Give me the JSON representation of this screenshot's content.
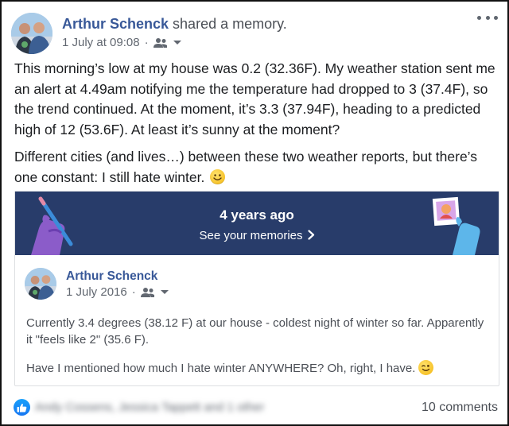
{
  "post": {
    "author": "Arthur Schenck",
    "action": " shared a memory.",
    "timestamp": "1 July at 09:08",
    "meta_separator": "·",
    "audience_icon": "friends-icon",
    "paragraphs": [
      "This morning’s low at my house was 0.2 (32.36F). My weather station sent me an alert at 4.49am notifying me the temperature had dropped to 3 (37.4F), so the trend continued. At the moment, it’s 3.3 (37.94F), heading to a predicted high of 12 (53.6F). At least it’s sunny at the moment?",
      "Different cities (and lives…) between these two weather reports, but there’s one constant: I still hate winter."
    ],
    "emoji": "smile-emoji"
  },
  "memory": {
    "years_ago": "4 years ago",
    "see_memories": "See your memories",
    "banner_color": "#283c6a",
    "original": {
      "author": "Arthur Schenck",
      "date": "1 July 2016",
      "meta_separator": "·",
      "paragraphs": [
        "Currently 3.4 degrees (38.12 F) at our house - coldest night of winter so far. Apparently it \"feels like 2\" (35.6 F).",
        "Have I mentioned how much I hate winter ANYWHERE? Oh, right, I have."
      ],
      "emoji": "wink-emoji"
    }
  },
  "footer": {
    "reaction_icon": "like-icon",
    "reactors": "Andy Cossens, Jessica Tappett and 1 other",
    "comments": "10 comments"
  },
  "colors": {
    "link": "#385898",
    "like_blue": "#1877f2"
  }
}
